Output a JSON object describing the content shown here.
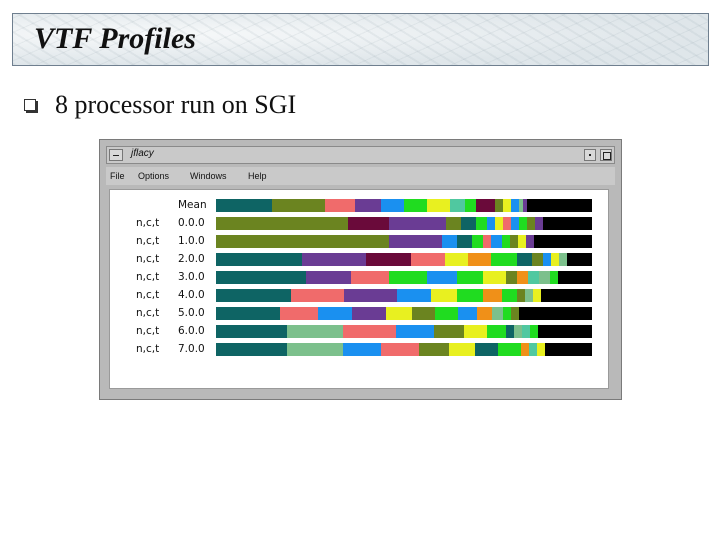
{
  "slide": {
    "title": "VTF Profiles",
    "bullet": "8 processor run on SGI"
  },
  "window": {
    "title": "jflacy",
    "menu": [
      "File",
      "Options",
      "Windows",
      "Help"
    ]
  },
  "colors": {
    "teal": "#0e6464",
    "olive": "#6b8420",
    "salmon": "#f06b6b",
    "purple": "#6a3c94",
    "blue": "#1a90f0",
    "green": "#20dc20",
    "lime": "#e8f020",
    "orange": "#f09018",
    "maroon": "#6a0a3a",
    "mint": "#7cc08c",
    "seafoam": "#50c8a0",
    "black": "#000000"
  },
  "chart_data": {
    "type": "bar",
    "stacked": true,
    "orientation": "horizontal",
    "rows": [
      {
        "label": "",
        "id": "Mean",
        "segments": [
          [
            "teal",
            0.15
          ],
          [
            "olive",
            0.14
          ],
          [
            "salmon",
            0.08
          ],
          [
            "purple",
            0.07
          ],
          [
            "blue",
            0.06
          ],
          [
            "green",
            0.06
          ],
          [
            "lime",
            0.06
          ],
          [
            "seafoam",
            0.04
          ],
          [
            "green",
            0.03
          ],
          [
            "maroon",
            0.05
          ],
          [
            "olive",
            0.02
          ],
          [
            "lime",
            0.02
          ],
          [
            "blue",
            0.02
          ],
          [
            "mint",
            0.01
          ],
          [
            "purple",
            0.01
          ],
          [
            "black",
            0.18
          ]
        ]
      },
      {
        "label": "n,c,t",
        "id": "0.0.0",
        "segments": [
          [
            "olive",
            0.35
          ],
          [
            "maroon",
            0.11
          ],
          [
            "purple",
            0.1
          ],
          [
            "purple",
            0.05
          ],
          [
            "olive",
            0.04
          ],
          [
            "teal",
            0.04
          ],
          [
            "green",
            0.03
          ],
          [
            "blue",
            0.02
          ],
          [
            "lime",
            0.02
          ],
          [
            "salmon",
            0.02
          ],
          [
            "blue",
            0.02
          ],
          [
            "green",
            0.02
          ],
          [
            "olive",
            0.02
          ],
          [
            "purple",
            0.02
          ],
          [
            "black",
            0.14
          ]
        ]
      },
      {
        "label": "n,c,t",
        "id": "1.0.0",
        "segments": [
          [
            "olive",
            0.46
          ],
          [
            "purple",
            0.09
          ],
          [
            "purple",
            0.05
          ],
          [
            "blue",
            0.04
          ],
          [
            "teal",
            0.04
          ],
          [
            "green",
            0.03
          ],
          [
            "salmon",
            0.02
          ],
          [
            "blue",
            0.03
          ],
          [
            "green",
            0.02
          ],
          [
            "olive",
            0.02
          ],
          [
            "lime",
            0.02
          ],
          [
            "purple",
            0.02
          ],
          [
            "black",
            0.16
          ]
        ]
      },
      {
        "label": "n,c,t",
        "id": "2.0.0",
        "segments": [
          [
            "teal",
            0.23
          ],
          [
            "purple",
            0.17
          ],
          [
            "maroon",
            0.12
          ],
          [
            "salmon",
            0.09
          ],
          [
            "lime",
            0.06
          ],
          [
            "orange",
            0.06
          ],
          [
            "green",
            0.07
          ],
          [
            "teal",
            0.04
          ],
          [
            "olive",
            0.03
          ],
          [
            "blue",
            0.02
          ],
          [
            "lime",
            0.02
          ],
          [
            "mint",
            0.02
          ],
          [
            "black",
            0.07
          ]
        ]
      },
      {
        "label": "n,c,t",
        "id": "3.0.0",
        "segments": [
          [
            "teal",
            0.24
          ],
          [
            "purple",
            0.12
          ],
          [
            "salmon",
            0.1
          ],
          [
            "green",
            0.1
          ],
          [
            "blue",
            0.08
          ],
          [
            "green",
            0.07
          ],
          [
            "lime",
            0.06
          ],
          [
            "olive",
            0.03
          ],
          [
            "orange",
            0.03
          ],
          [
            "seafoam",
            0.03
          ],
          [
            "mint",
            0.03
          ],
          [
            "green",
            0.02
          ],
          [
            "black",
            0.09
          ]
        ]
      },
      {
        "label": "n,c,t",
        "id": "4.0.0",
        "segments": [
          [
            "teal",
            0.2
          ],
          [
            "salmon",
            0.14
          ],
          [
            "purple",
            0.14
          ],
          [
            "blue",
            0.09
          ],
          [
            "lime",
            0.07
          ],
          [
            "green",
            0.07
          ],
          [
            "orange",
            0.05
          ],
          [
            "green",
            0.04
          ],
          [
            "olive",
            0.02
          ],
          [
            "mint",
            0.02
          ],
          [
            "lime",
            0.02
          ],
          [
            "black",
            0.14
          ]
        ]
      },
      {
        "label": "n,c,t",
        "id": "5.0.0",
        "segments": [
          [
            "teal",
            0.17
          ],
          [
            "salmon",
            0.1
          ],
          [
            "blue",
            0.09
          ],
          [
            "purple",
            0.09
          ],
          [
            "lime",
            0.07
          ],
          [
            "olive",
            0.06
          ],
          [
            "green",
            0.06
          ],
          [
            "blue",
            0.05
          ],
          [
            "orange",
            0.04
          ],
          [
            "mint",
            0.03
          ],
          [
            "green",
            0.02
          ],
          [
            "olive",
            0.02
          ],
          [
            "black",
            0.2
          ]
        ]
      },
      {
        "label": "n,c,t",
        "id": "6.0.0",
        "segments": [
          [
            "teal",
            0.19
          ],
          [
            "mint",
            0.15
          ],
          [
            "salmon",
            0.14
          ],
          [
            "blue",
            0.1
          ],
          [
            "olive",
            0.08
          ],
          [
            "lime",
            0.06
          ],
          [
            "green",
            0.05
          ],
          [
            "teal",
            0.02
          ],
          [
            "mint",
            0.02
          ],
          [
            "seafoam",
            0.02
          ],
          [
            "green",
            0.02
          ],
          [
            "black",
            0.15
          ]
        ]
      },
      {
        "label": "n,c,t",
        "id": "7.0.0",
        "segments": [
          [
            "teal",
            0.19
          ],
          [
            "mint",
            0.15
          ],
          [
            "blue",
            0.1
          ],
          [
            "salmon",
            0.1
          ],
          [
            "olive",
            0.08
          ],
          [
            "lime",
            0.07
          ],
          [
            "teal",
            0.06
          ],
          [
            "green",
            0.06
          ],
          [
            "orange",
            0.02
          ],
          [
            "seafoam",
            0.02
          ],
          [
            "lime",
            0.02
          ],
          [
            "black",
            0.13
          ]
        ]
      }
    ]
  }
}
